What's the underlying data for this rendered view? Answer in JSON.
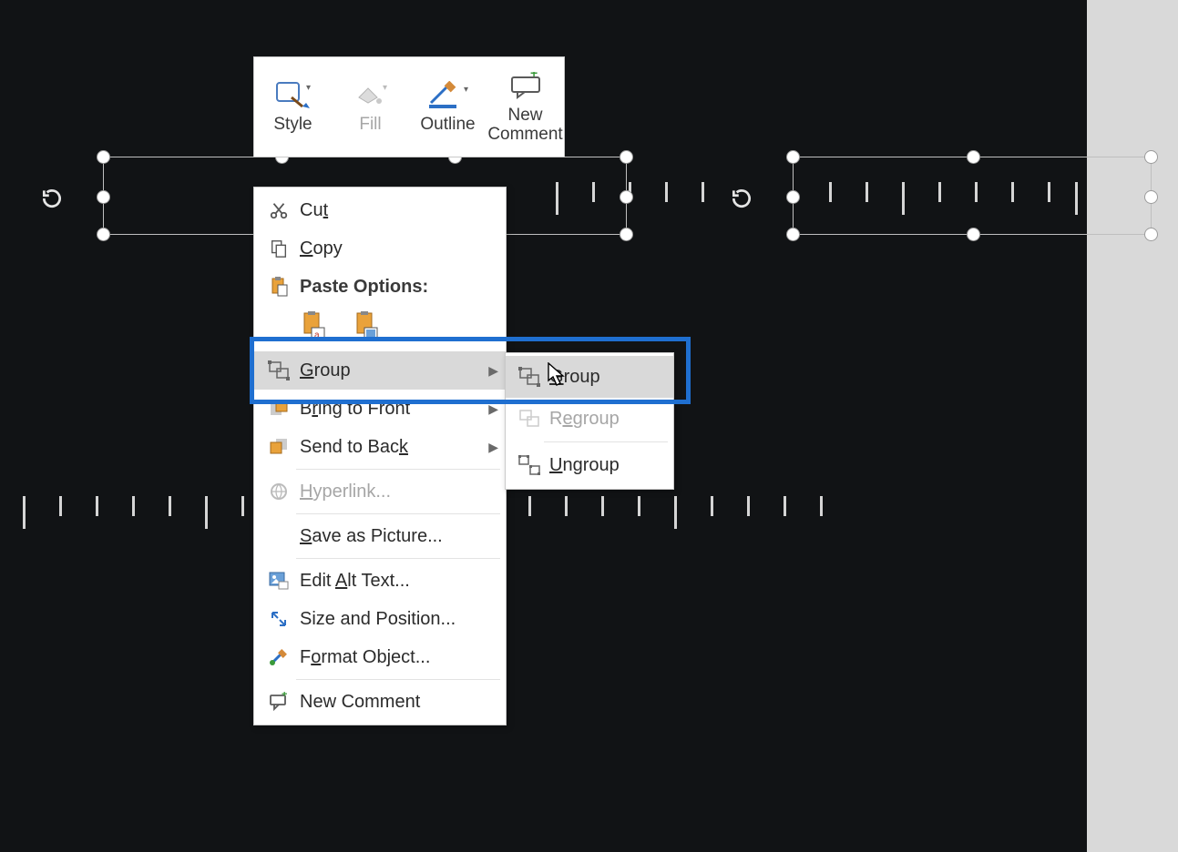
{
  "mini_toolbar": {
    "style": "Style",
    "fill": "Fill",
    "outline": "Outline",
    "new_comment": "New\nComment"
  },
  "context_menu": {
    "cut": "Cut",
    "copy": "Copy",
    "paste_options": "Paste Options:",
    "group": "Group",
    "bring_to_front": "Bring to Front",
    "send_to_back": "Send to Back",
    "hyperlink": "Hyperlink...",
    "save_as_picture": "Save as Picture...",
    "edit_alt_text": "Edit Alt Text...",
    "size_and_position": "Size and Position...",
    "format_object": "Format Object...",
    "new_comment": "New Comment"
  },
  "submenu": {
    "group": "Group",
    "regroup": "Regroup",
    "ungroup": "Ungroup"
  }
}
